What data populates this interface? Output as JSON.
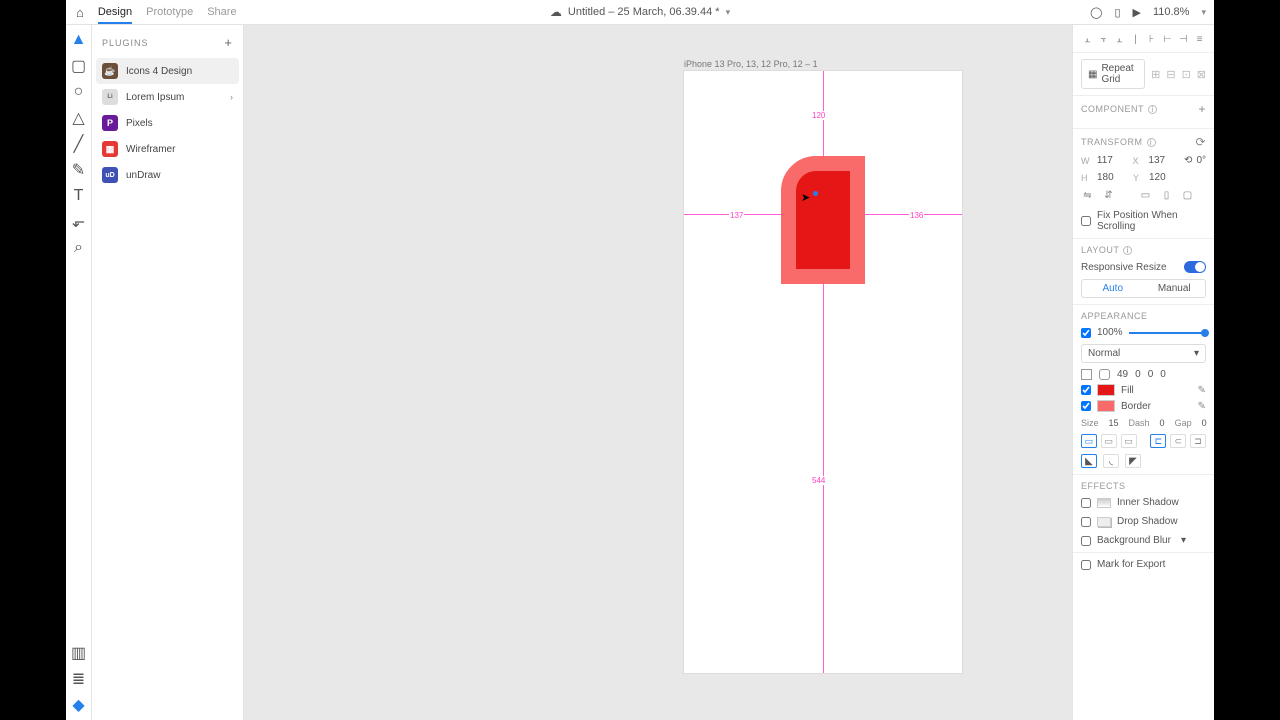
{
  "topbar": {
    "tabs": {
      "design": "Design",
      "prototype": "Prototype",
      "share": "Share"
    },
    "title": "Untitled – 25 March, 06.39.44 *",
    "zoom": "110.8%"
  },
  "plugins": {
    "header": "PLUGINS",
    "items": [
      {
        "label": "Icons 4 Design"
      },
      {
        "label": "Lorem Ipsum"
      },
      {
        "label": "Pixels"
      },
      {
        "label": "Wireframer"
      },
      {
        "label": "unDraw"
      }
    ]
  },
  "canvas": {
    "artboard_name": "iPhone 13 Pro, 13, 12 Pro, 12 – 1",
    "dist_top": "120",
    "dist_left": "137",
    "dist_right": "136",
    "dist_bottom": "544"
  },
  "inspector": {
    "repeat_grid": "Repeat Grid",
    "component": "COMPONENT",
    "transform": {
      "title": "TRANSFORM",
      "w": "117",
      "x": "137",
      "h": "180",
      "y": "120",
      "rotation": "0°",
      "fix_label": "Fix Position When Scrolling"
    },
    "layout": {
      "title": "LAYOUT",
      "responsive": "Responsive Resize",
      "auto": "Auto",
      "manual": "Manual"
    },
    "appearance": {
      "title": "APPEARANCE",
      "opacity": "100%",
      "blend": "Normal",
      "corner": {
        "tl": "49",
        "tr": "0",
        "br": "0",
        "bl": "0"
      },
      "fill_label": "Fill",
      "fill_color": "#e41616",
      "border_label": "Border",
      "border_color": "#f96a6a",
      "size_label": "Size",
      "size_val": "15",
      "dash_label": "Dash",
      "dash_val": "0",
      "gap_label": "Gap",
      "gap_val": "0"
    },
    "effects": {
      "title": "EFFECTS",
      "inner": "Inner Shadow",
      "drop": "Drop Shadow",
      "blur": "Background Blur"
    },
    "export": "Mark for Export"
  }
}
